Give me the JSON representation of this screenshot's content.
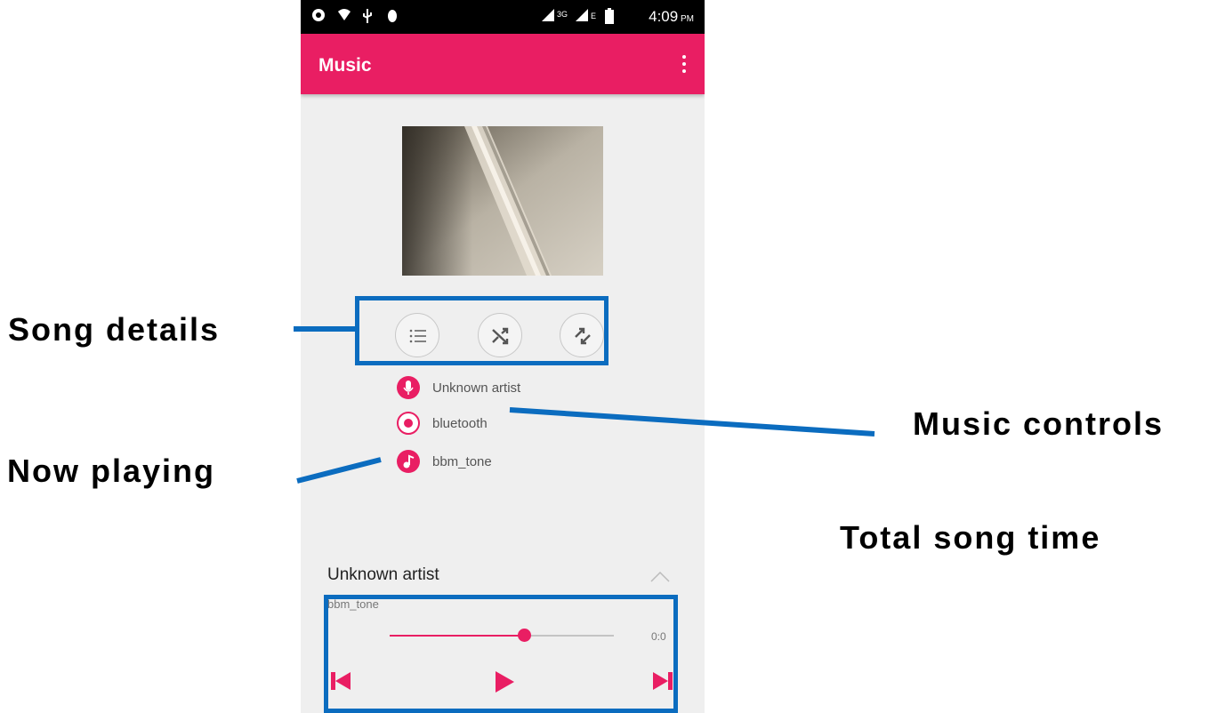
{
  "status_bar": {
    "time": "4:09",
    "ampm": "PM",
    "network": "3G",
    "signal2": "E"
  },
  "app_bar": {
    "title": "Music"
  },
  "controls": {
    "items": [
      {
        "name": "song-details",
        "icon": "list-icon"
      },
      {
        "name": "shuffle",
        "icon": "shuffle-icon"
      },
      {
        "name": "repeat",
        "icon": "repeat-icon"
      }
    ]
  },
  "info": {
    "artist": "Unknown artist",
    "album": "bluetooth",
    "title": "bbm_tone"
  },
  "now_playing": {
    "artist": "Unknown artist",
    "title": "bbm_tone",
    "time": "0:0",
    "progress": 0.6
  },
  "annotations": {
    "song_details": "Song details",
    "now_playing": "Now playing",
    "music_controls": "Music controls",
    "total_song_time": "Total song time"
  },
  "colors": {
    "accent": "#e91e63",
    "annotation": "#0b6cbf",
    "status_bar": "#000000",
    "background": "#efefef"
  }
}
